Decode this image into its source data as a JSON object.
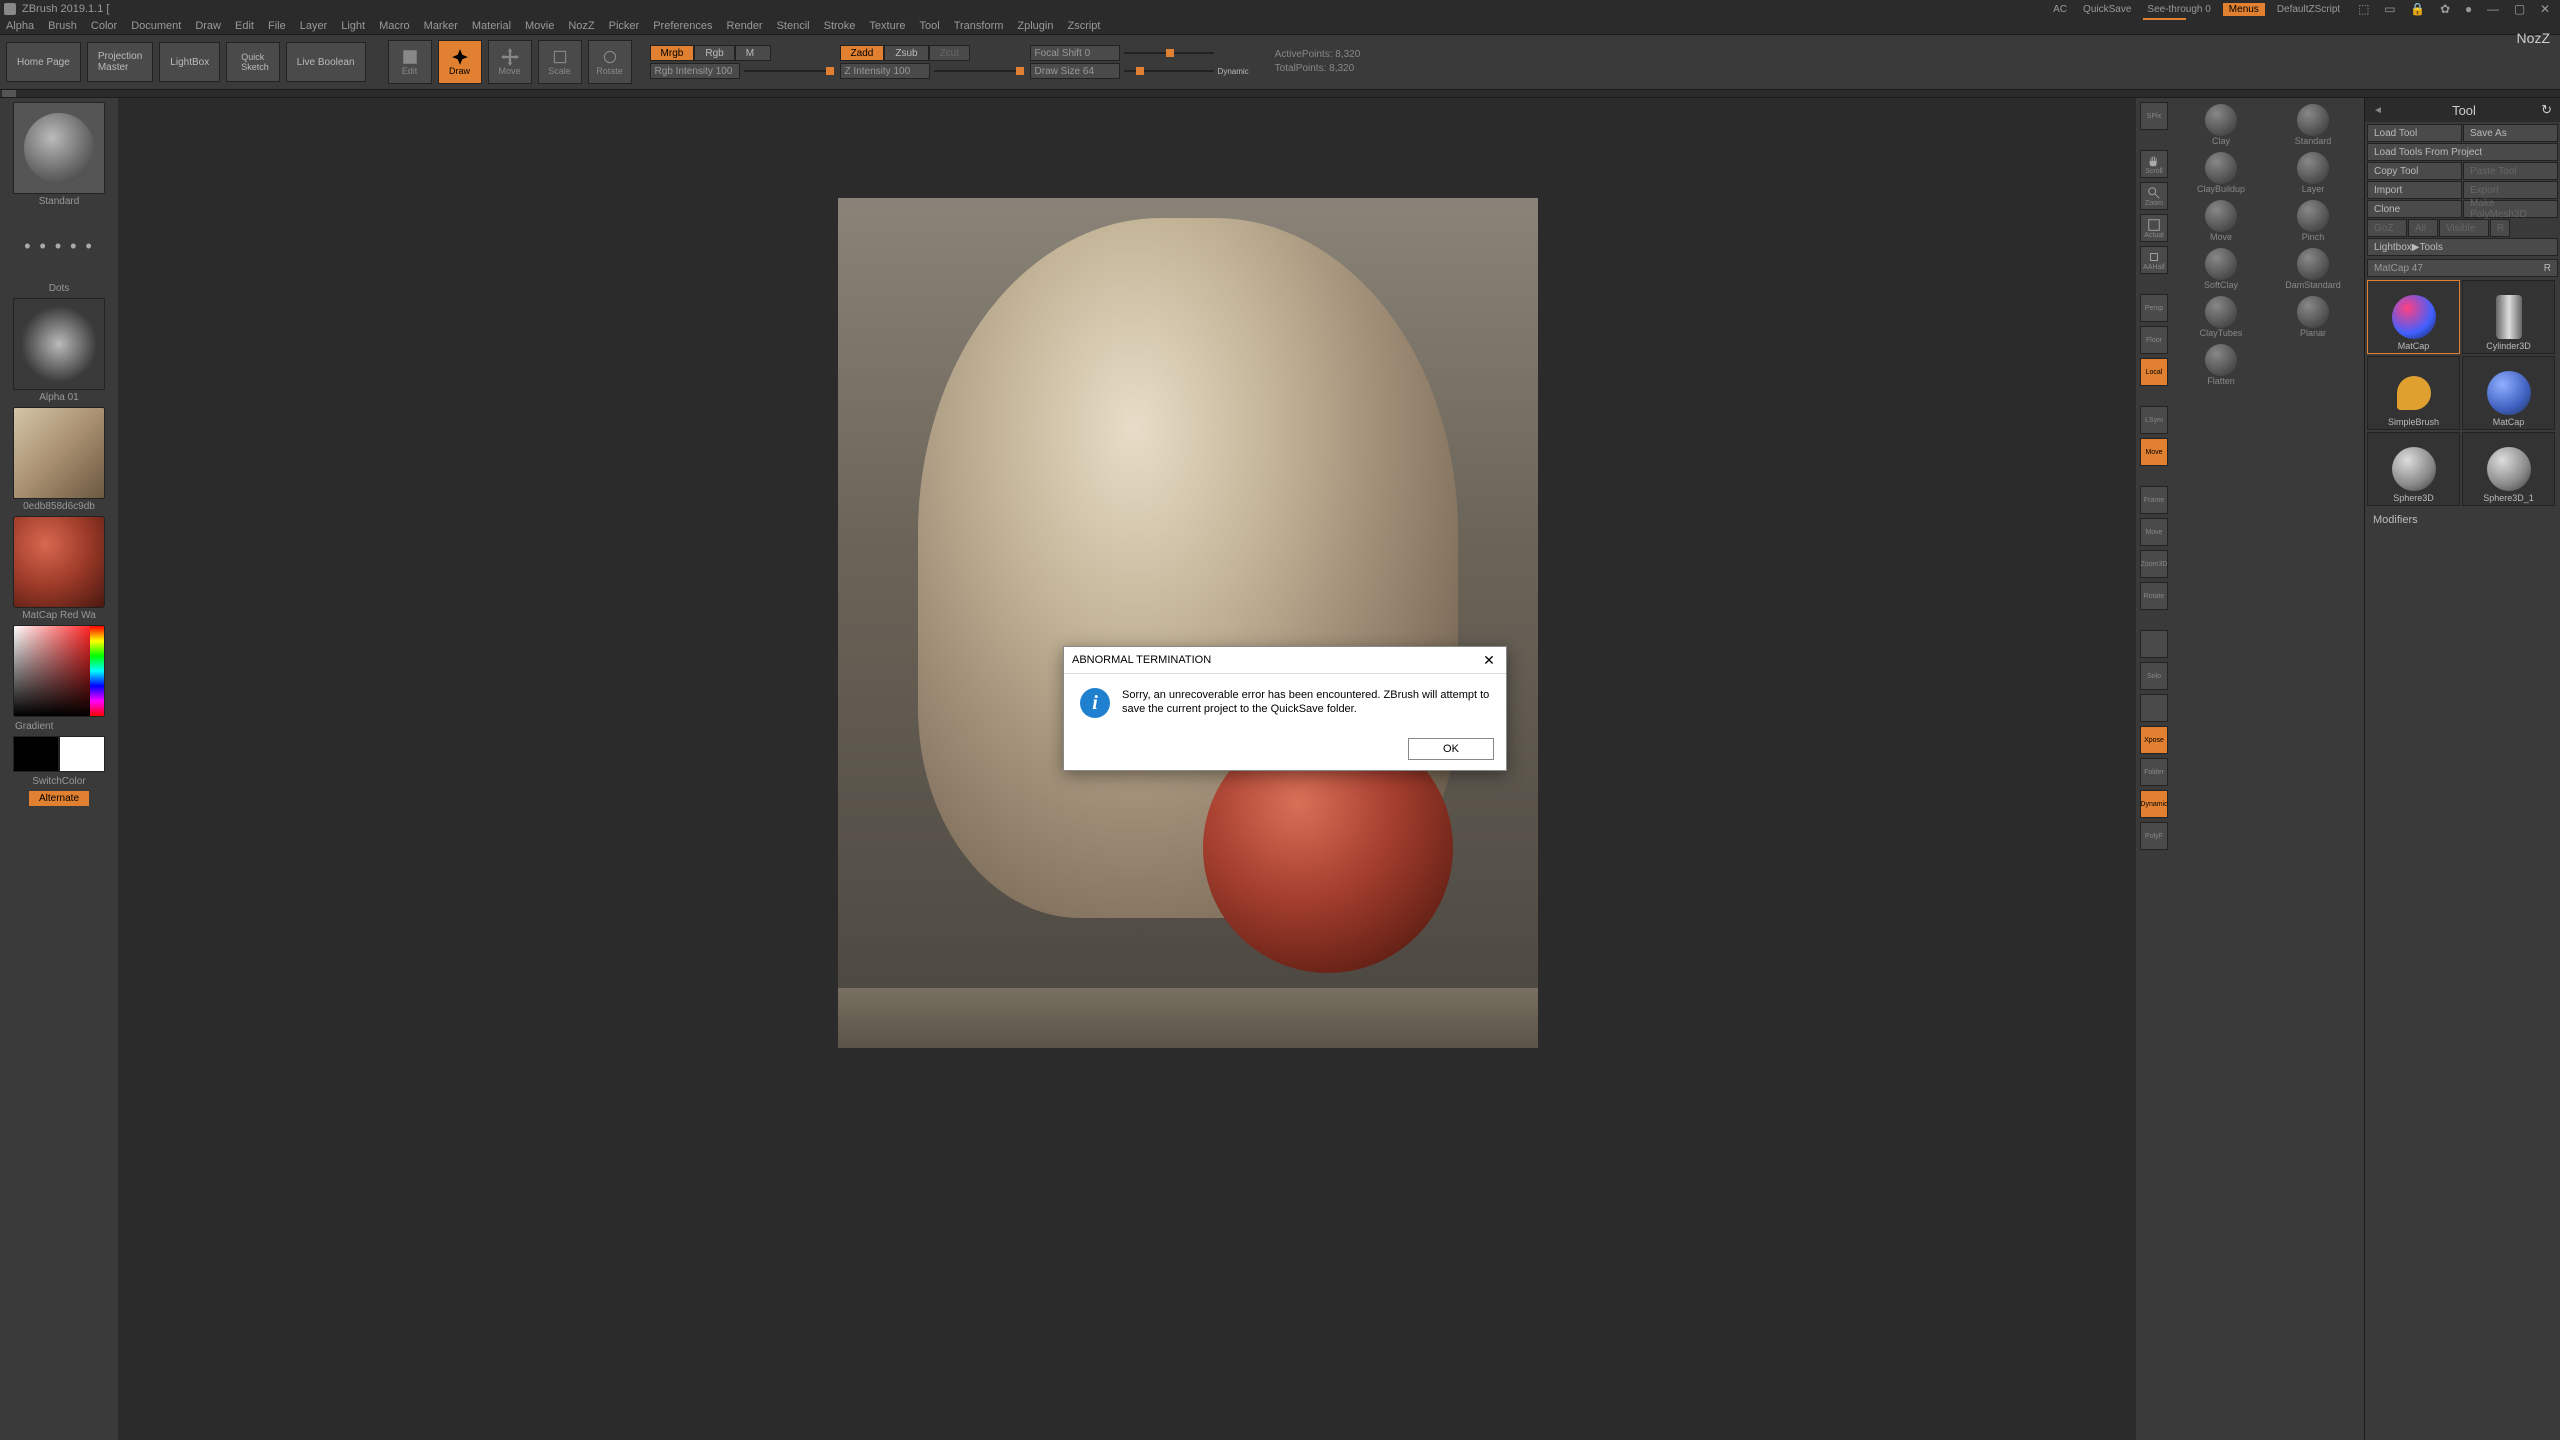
{
  "title": "ZBrush 2019.1.1 [",
  "titlebar": {
    "ac": "AC",
    "quicksave": "QuickSave",
    "seethrough": "See-through  0",
    "menus": "Menus",
    "defaultscript": "DefaultZScript"
  },
  "menu": [
    "Alpha",
    "Brush",
    "Color",
    "Document",
    "Draw",
    "Edit",
    "File",
    "Layer",
    "Light",
    "Macro",
    "Marker",
    "Material",
    "Movie",
    "NozZ",
    "Picker",
    "Preferences",
    "Render",
    "Stencil",
    "Stroke",
    "Texture",
    "Tool",
    "Transform",
    "Zplugin",
    "Zscript"
  ],
  "nozz": "NozZ",
  "toolbar": {
    "home": "Home Page",
    "projection": "Projection\nMaster ",
    "lightbox": "LightBox",
    "quicksketch": "Quick\nSketch",
    "liveboolean": "Live Boolean",
    "edit": "Edit",
    "draw": "Draw",
    "move": "Move",
    "scale": "Scale",
    "rotate": "Rotate",
    "rgb_row": {
      "mrgb": "Mrgb",
      "rgb": "Rgb",
      "m": "M"
    },
    "z_row": {
      "zadd": "Zadd",
      "zsub": "Zsub",
      "zcut": "Zcut"
    },
    "rgb_intensity": "Rgb Intensity 100",
    "z_intensity": "Z Intensity 100",
    "focal_shift": "Focal Shift 0",
    "draw_size": "Draw Size 64",
    "dynamic": "Dynamic",
    "active_points": "ActivePoints: 8,320",
    "total_points": "TotalPoints: 8,320"
  },
  "left": {
    "brush": "Standard",
    "stroke": "Dots",
    "alpha": "Alpha 01",
    "texture": "0edb858d6c9db",
    "material": "MatCap Red Wa",
    "gradient": "Gradient",
    "switchcolor": "SwitchColor",
    "alternate": "Alternate"
  },
  "right_strip": [
    "SPix",
    "Scroll",
    "Zoom",
    "Actual",
    "AAHalf",
    "Persp",
    "Floor",
    "Local",
    "LSym",
    "Move",
    "Frame",
    "Move",
    "Zoom3D",
    "Rotate",
    "",
    "Solo",
    "",
    "Xpose",
    "Folder",
    "Dynamic",
    "PolyF"
  ],
  "brush_palette": [
    [
      "Clay",
      "Standard"
    ],
    [
      "ClayBuildup",
      "Layer"
    ],
    [
      "Move",
      "Pinch"
    ],
    [
      "SoftClay",
      "DamStandard"
    ],
    [
      "ClayTubes",
      "Planar"
    ],
    [
      "Flatten",
      ""
    ]
  ],
  "tool_panel": {
    "header": "Tool",
    "load_tool": "Load Tool",
    "save_as": "Save As",
    "load_from_project": "Load Tools From Project",
    "copy_tool": "Copy Tool",
    "paste_tool": "Paste Tool",
    "import": "Import",
    "export": "Export",
    "clone": "Clone",
    "make_polymesh": "Make PolyMesh3D",
    "goz": "GoZ",
    "all": "All",
    "visible": "Visible",
    "r": "R",
    "lightbox_tools": "Lightbox▶Tools",
    "matcap_slider": "MatCap  47",
    "matcap_r": "R",
    "thumbs": [
      {
        "label": "MatCap",
        "active": true,
        "type": "matcap"
      },
      {
        "label": "Cylinder3D",
        "type": "cylinder"
      },
      {
        "label": "SimpleBrush",
        "type": "simple"
      },
      {
        "label": "MatCap",
        "type": "matcap2"
      },
      {
        "label": "Sphere3D",
        "type": "sphere"
      },
      {
        "label": "Sphere3D_1",
        "type": "sphere"
      }
    ],
    "modifiers": "Modifiers"
  },
  "dialog": {
    "title": "ABNORMAL TERMINATION",
    "message": "Sorry, an unrecoverable error has been encountered. ZBrush will attempt to save the current project to the QuickSave folder.",
    "ok": "OK"
  }
}
